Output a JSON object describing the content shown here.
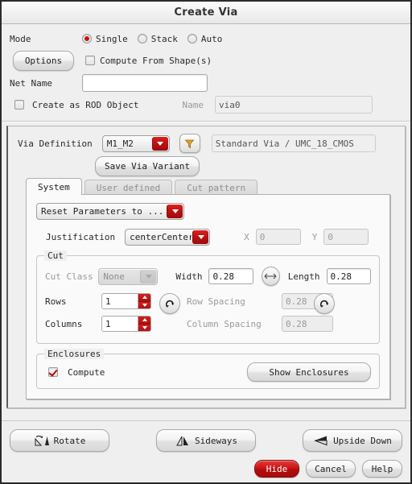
{
  "window": {
    "title": "Create Via"
  },
  "mode": {
    "label": "Mode",
    "options": [
      {
        "label": "Single",
        "selected": true
      },
      {
        "label": "Stack",
        "selected": false
      },
      {
        "label": "Auto",
        "selected": false
      }
    ],
    "options_button": "Options",
    "compute_from_shapes": {
      "label": "Compute From Shape(s)",
      "checked": false
    }
  },
  "net": {
    "label": "Net Name",
    "value": "",
    "placeholder": ""
  },
  "rod": {
    "checkbox_label": "Create as ROD Object",
    "checked": false,
    "name_label": "Name",
    "name_value": "via0"
  },
  "via_definition": {
    "label": "Via Definition",
    "value": "M1_M2",
    "filter_icon": "funnel-filter-icon",
    "description": "Standard Via / UMC_18_CMOS",
    "save_variant_button": "Save Via Variant"
  },
  "tabs": [
    {
      "label": "System",
      "active": true
    },
    {
      "label": "User defined",
      "active": false
    },
    {
      "label": "Cut pattern",
      "active": false
    }
  ],
  "system_tab": {
    "reset_combo": "Reset Parameters to ...",
    "justification": {
      "label": "Justification",
      "value": "centerCenter",
      "x_label": "X",
      "x_value": "0",
      "y_label": "Y",
      "y_value": "0"
    },
    "cut": {
      "group_title": "Cut",
      "cut_class_label": "Cut Class",
      "cut_class_value": "None",
      "width_label": "Width",
      "width_value": "0.28",
      "swap_icon": "swap-arrows-icon",
      "length_label": "Length",
      "length_value": "0.28",
      "rows_label": "Rows",
      "rows_value": "1",
      "columns_label": "Columns",
      "columns_value": "1",
      "row_spacing_label": "Row Spacing",
      "row_spacing_value": "0.28",
      "column_spacing_label": "Column Spacing",
      "column_spacing_value": "0.28",
      "reset_icon": "circular-arrow-icon"
    },
    "enclosures": {
      "group_title": "Enclosures",
      "compute_label": "Compute",
      "compute_checked": true,
      "show_button": "Show Enclosures"
    }
  },
  "transform_buttons": [
    {
      "label": "Rotate",
      "icon": "rotate-icon"
    },
    {
      "label": "Sideways",
      "icon": "sideways-flip-icon"
    },
    {
      "label": "Upside Down",
      "icon": "upside-down-icon"
    }
  ],
  "action_buttons": [
    {
      "label": "Hide",
      "style": "red"
    },
    {
      "label": "Cancel",
      "style": "normal"
    },
    {
      "label": "Help",
      "style": "normal"
    }
  ],
  "colors": {
    "accent_red": "#bb1010",
    "hide_red": "#cc1111",
    "filter_orange": "#e8a022",
    "window_bg": "#efefef"
  }
}
